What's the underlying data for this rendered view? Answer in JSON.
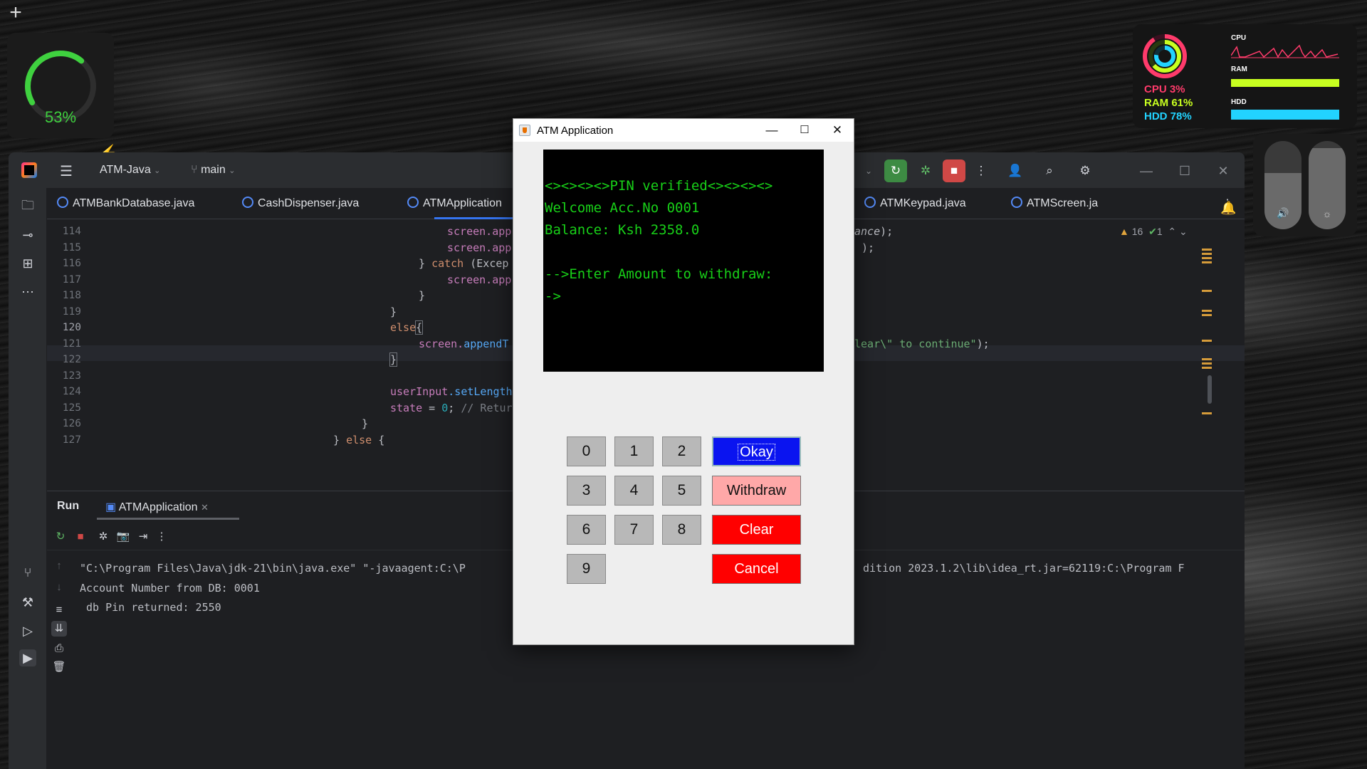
{
  "desktop": {
    "battery_percent": "53%",
    "battery_level": 0.53,
    "stats": {
      "cpu": "CPU 3%",
      "ram": "RAM 61%",
      "hdd": "HDD 78%"
    },
    "graph_labels": {
      "cpu": "CPU",
      "ram": "RAM",
      "hdd": "HDD"
    },
    "colors": {
      "cpu": "#ff3b6b",
      "ram": "#c8ff20",
      "hdd": "#22d3ff",
      "battery": "#3fd13f"
    }
  },
  "ide": {
    "project": "ATM-Java",
    "branch": "main",
    "tabs": [
      "ATMBankDatabase.java",
      "CashDispenser.java",
      "ATMApplication",
      "ATMKeypad.java",
      "ATMScreen.ja"
    ],
    "inspections": {
      "warnings": "16",
      "ok": "1"
    },
    "line_numbers": [
      "114",
      "115",
      "116",
      "117",
      "118",
      "119",
      "120",
      "121",
      "122",
      "123",
      "124",
      "125",
      "126",
      "127"
    ],
    "code": {
      "l114": "screen.app",
      "l115": "screen.app",
      "l116a": "} ",
      "l116b": "catch",
      "l116c": " (Excep",
      "l117": "screen.app",
      "l118": "}",
      "l119": "}",
      "l120a": "else",
      "l120b": "{",
      "l121a": "screen.",
      "l121b": "appendT",
      "l122": "}",
      "l124a": "userInput",
      "l124b": ".setLength",
      "l125a": "state",
      "l125b": " = ",
      "l125c": "0",
      "l125d": "; ",
      "l125e": "// Retur",
      "l126": "}",
      "l127a": "} ",
      "l127b": "else",
      "l127c": " {",
      "r114a": "ance",
      "r114b": ");",
      "r115": ");",
      "r121a": "lear\\\" to continue\"",
      "r121b": ");"
    },
    "run": {
      "title": "Run",
      "tab": "ATMApplication",
      "console_line1": "\"C:\\Program Files\\Java\\jdk-21\\bin\\java.exe\" \"-javaagent:C:\\P",
      "console_line1_right": "dition 2023.1.2\\lib\\idea_rt.jar=62119:C:\\Program F",
      "console_line2": "Account Number from DB: 0001",
      "console_line3": " db Pin returned: 2550"
    }
  },
  "atm": {
    "title": "ATM Application",
    "screen_lines": [
      "<><><><>PIN verified<><><><>",
      "Welcome Acc.No 0001",
      "Balance: Ksh 2358.0",
      "",
      "-->Enter Amount to withdraw:",
      "->"
    ],
    "keys": [
      "0",
      "1",
      "2",
      "3",
      "4",
      "5",
      "6",
      "7",
      "8",
      "9"
    ],
    "actions": {
      "okay": "Okay",
      "withdraw": "Withdraw",
      "clear": "Clear",
      "cancel": "Cancel"
    },
    "colors": {
      "okay": "#0a14f0",
      "withdraw": "#ffa8a8",
      "clear": "#ff0000",
      "cancel": "#ff0000",
      "screen_text": "#18d018"
    }
  }
}
